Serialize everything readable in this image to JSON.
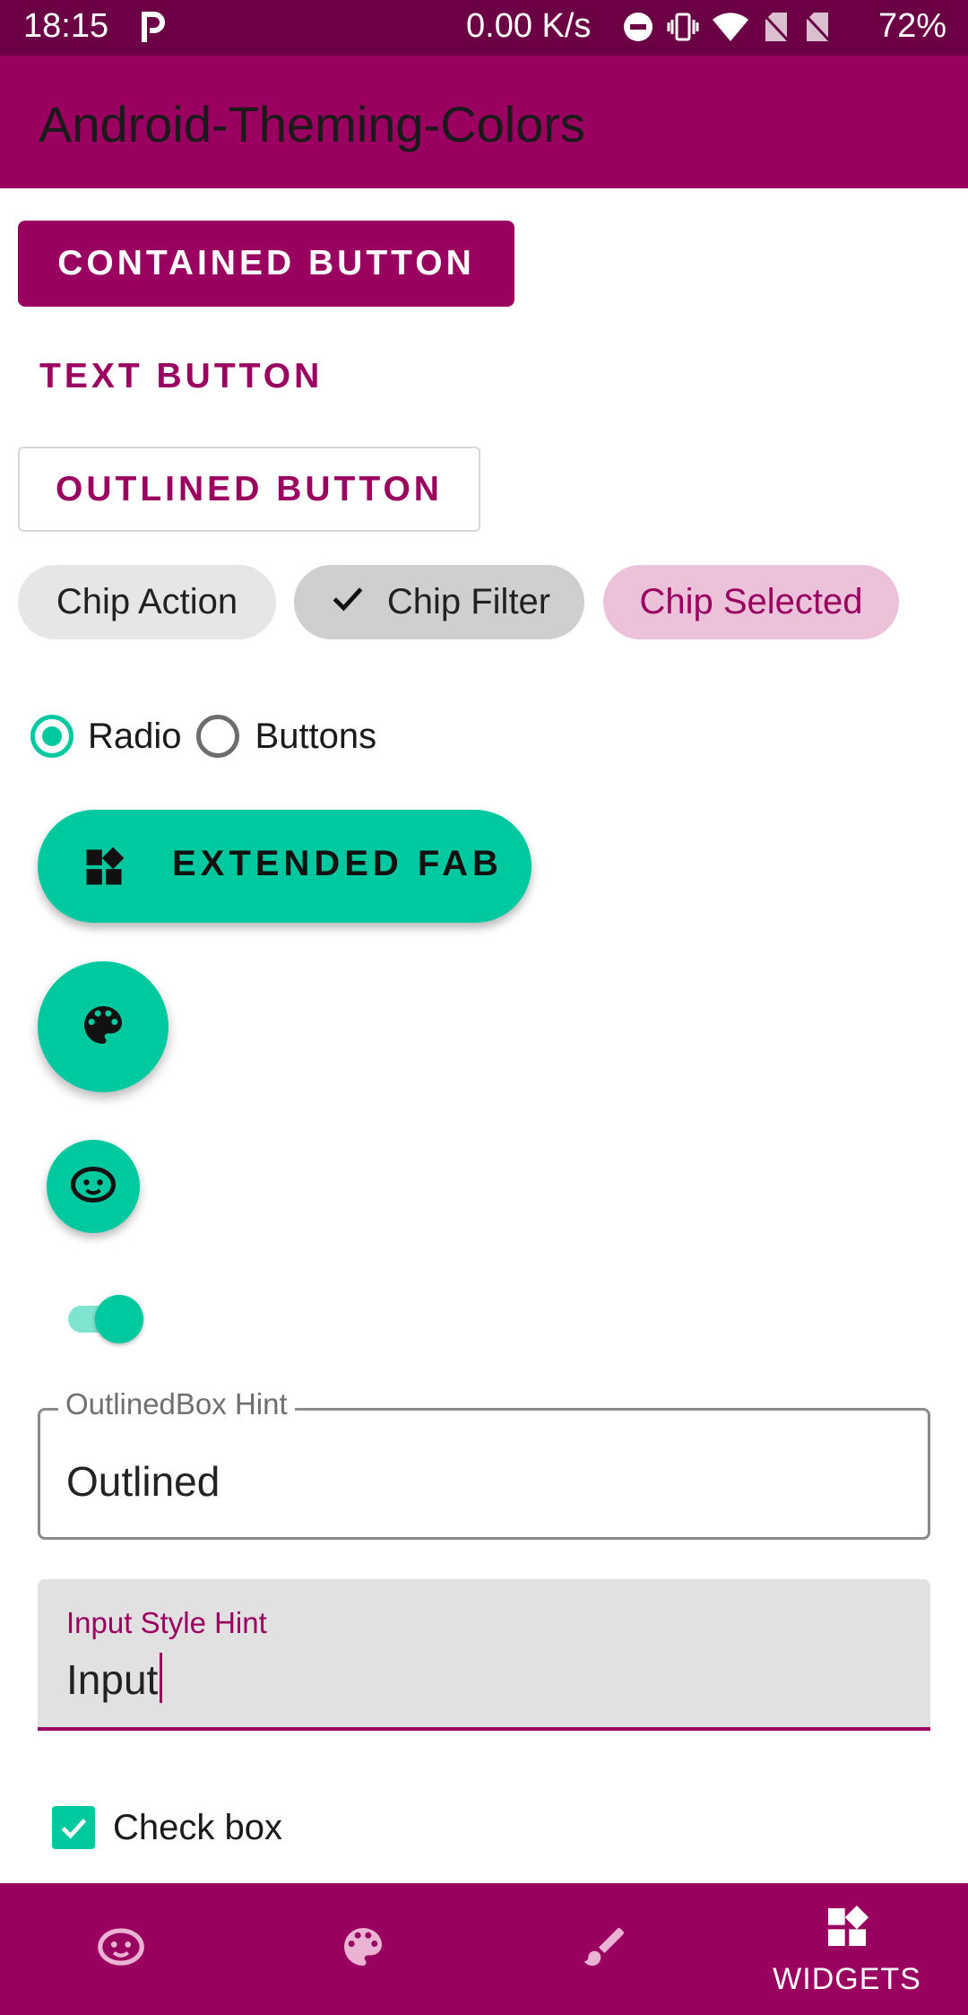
{
  "status_bar": {
    "time": "18:15",
    "network_speed": "0.00 K/s",
    "battery": "72%",
    "icons": [
      "parking-icon",
      "do-not-disturb-icon",
      "vibrate-icon",
      "wifi-icon",
      "no-sim-icon",
      "no-sim-icon",
      "battery"
    ]
  },
  "app_bar": {
    "title": "Android-Theming-Colors"
  },
  "buttons": {
    "contained": "CONTAINED BUTTON",
    "text": "TEXT BUTTON",
    "outlined": "OUTLINED BUTTON"
  },
  "chips": {
    "action": "Chip Action",
    "filter": "Chip Filter",
    "selected": "Chip Selected"
  },
  "radio": {
    "option1": "Radio",
    "option2": "Buttons",
    "selected": "Radio"
  },
  "extended_fab": {
    "label": "EXTENDED FAB",
    "icon": "widgets-icon"
  },
  "fab_large": {
    "icon": "palette-icon"
  },
  "fab_small": {
    "icon": "face-icon"
  },
  "switch": {
    "checked": true
  },
  "outlined_field": {
    "hint": "OutlinedBox Hint",
    "value": "Outlined"
  },
  "filled_field": {
    "hint": "Input Style Hint",
    "value": "Input"
  },
  "checkbox": {
    "label": "Check box",
    "checked": true
  },
  "bottom_nav": {
    "items": [
      {
        "icon": "face-icon",
        "label": ""
      },
      {
        "icon": "palette-icon",
        "label": ""
      },
      {
        "icon": "brush-icon",
        "label": ""
      },
      {
        "icon": "widgets-icon",
        "label": "WIDGETS"
      }
    ],
    "selected": "WIDGETS"
  },
  "colors": {
    "primary": "#99005f",
    "primary_dark": "#6b0044",
    "secondary": "#00c9a0",
    "chip_selected_bg": "#ecc2da"
  }
}
